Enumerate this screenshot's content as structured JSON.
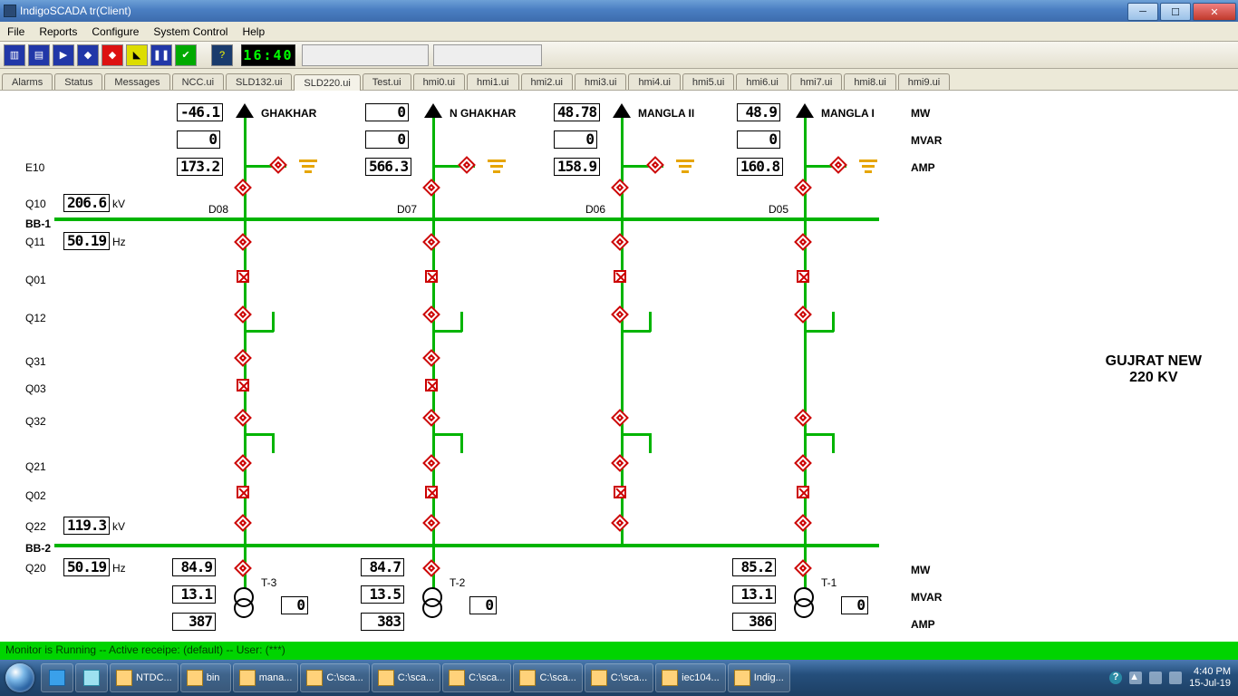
{
  "window": {
    "title": "IndigoSCADA tr(Client)"
  },
  "menu": {
    "file": "File",
    "reports": "Reports",
    "configure": "Configure",
    "system": "System Control",
    "help": "Help"
  },
  "toolbar": {
    "clock": "16:40"
  },
  "tabs": {
    "items": [
      {
        "label": "Alarms"
      },
      {
        "label": "Status"
      },
      {
        "label": "Messages"
      },
      {
        "label": "NCC.ui"
      },
      {
        "label": "SLD132.ui"
      },
      {
        "label": "SLD220.ui"
      },
      {
        "label": "Test.ui"
      },
      {
        "label": "hmi0.ui"
      },
      {
        "label": "hmi1.ui"
      },
      {
        "label": "hmi2.ui"
      },
      {
        "label": "hmi3.ui"
      },
      {
        "label": "hmi4.ui"
      },
      {
        "label": "hmi5.ui"
      },
      {
        "label": "hmi6.ui"
      },
      {
        "label": "hmi7.ui"
      },
      {
        "label": "hmi8.ui"
      },
      {
        "label": "hmi9.ui"
      }
    ],
    "activeIndex": 5
  },
  "units": {
    "mw": "MW",
    "mvar": "MVAR",
    "amp": "AMP"
  },
  "left_labels": {
    "E10": "E10",
    "Q10": "Q10",
    "BB1": "BB-1",
    "Q11": "Q11",
    "Q01": "Q01",
    "Q12": "Q12",
    "Q31": "Q31",
    "Q03": "Q03",
    "Q32": "Q32",
    "Q21": "Q21",
    "Q02": "Q02",
    "Q22": "Q22",
    "BB2": "BB-2",
    "Q20": "Q20",
    "kv": "kV",
    "hz": "Hz"
  },
  "left_vals": {
    "Q10": "206.6",
    "Q11": "50.19",
    "Q22": "119.3",
    "Q20": "50.19"
  },
  "feeders": [
    {
      "name": "GHAKHAR",
      "id": "D08",
      "mw": "-46.1",
      "mvar": "0",
      "amp": "173.2"
    },
    {
      "name": "N GHAKHAR",
      "id": "D07",
      "mw": "0",
      "mvar": "0",
      "amp": "566.3"
    },
    {
      "name": "MANGLA II",
      "id": "D06",
      "mw": "48.78",
      "mvar": "0",
      "amp": "158.9"
    },
    {
      "name": "MANGLA I",
      "id": "D05",
      "mw": "48.9",
      "mvar": "0",
      "amp": "160.8"
    }
  ],
  "trafos": [
    {
      "name": "T-3",
      "mw": "84.9",
      "mvar": "13.1",
      "amp": "387",
      "tap": "0"
    },
    {
      "name": "T-2",
      "mw": "84.7",
      "mvar": "13.5",
      "amp": "383",
      "tap": "0"
    },
    {
      "name": "T-1",
      "mw": "85.2",
      "mvar": "13.1",
      "amp": "386",
      "tap": "0"
    }
  ],
  "station": {
    "line1": "GUJRAT NEW",
    "line2": "220 KV"
  },
  "status": "Monitor is Running -- Active receipe: (default) -- User: (***)",
  "taskbar": {
    "items": [
      {
        "label": "NTDC..."
      },
      {
        "label": "bin"
      },
      {
        "label": "mana..."
      },
      {
        "label": "C:\\sca..."
      },
      {
        "label": "C:\\sca..."
      },
      {
        "label": "C:\\sca..."
      },
      {
        "label": "C:\\sca..."
      },
      {
        "label": "C:\\sca..."
      },
      {
        "label": "iec104..."
      },
      {
        "label": "Indig..."
      }
    ],
    "time": "4:40 PM",
    "date": "15-Jul-19"
  }
}
